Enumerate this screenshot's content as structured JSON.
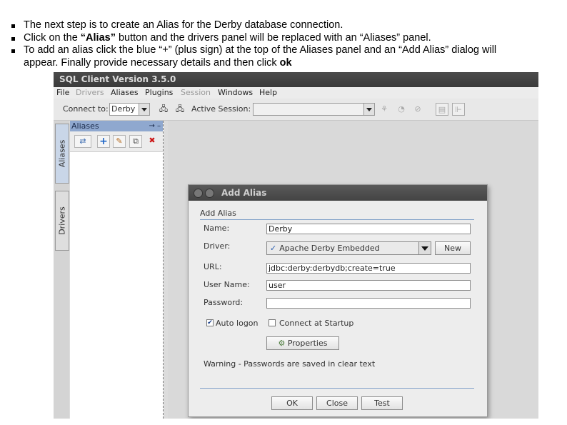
{
  "slide": {
    "bullets": [
      {
        "text": "The next step is to create an Alias for the Derby database connection."
      },
      {
        "pre": "Click on the ",
        "bold": "“Alias”",
        "post": " button and the drivers panel will be replaced with an “Aliases” panel."
      },
      {
        "line": "To add an alias click the blue “+” (plus sign) at the top of the Aliases panel and an “Add Alias” dialog will",
        "pre": "appear. Finally provide necessary details and then click ",
        "bold": "ok"
      }
    ]
  },
  "window": {
    "title": "SQL Client Version 3.5.0"
  },
  "menu": [
    "File",
    "Drivers",
    "Aliases",
    "Plugins",
    "Session",
    "Windows",
    "Help"
  ],
  "toolbar": {
    "connect_label": "Connect to:",
    "connect_value": "Derby",
    "active_session_label": "Active Session:",
    "active_session_value": ""
  },
  "side_tabs": {
    "aliases": "Aliases",
    "drivers": "Drivers"
  },
  "aliases_panel": {
    "title": "Aliases",
    "controls": "→ –"
  },
  "dialog": {
    "title": "Add Alias",
    "section": "Add Alias",
    "fields": {
      "name_label": "Name:",
      "name_value": "Derby",
      "driver_label": "Driver:",
      "driver_value": "Apache Derby Embedded",
      "new_button": "New",
      "url_label": "URL:",
      "url_value": "jdbc:derby:derbydb;create=true",
      "user_label": "User Name:",
      "user_value": "user",
      "password_label": "Password:",
      "password_value": ""
    },
    "auto_logon": {
      "label": "Auto logon",
      "checked": true
    },
    "connect_startup": {
      "label": "Connect at Startup",
      "checked": false
    },
    "properties_button": "Properties",
    "warning": "Warning - Passwords are saved in clear text",
    "buttons": {
      "ok": "OK",
      "close": "Close",
      "test": "Test"
    }
  }
}
